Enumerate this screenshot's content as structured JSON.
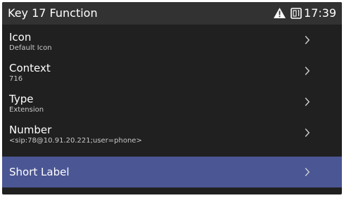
{
  "header": {
    "title": "Key 17 Function",
    "time": "17:39",
    "warning_icon": "warning-icon",
    "line_icon": "line-key-1-icon"
  },
  "menu": {
    "items": [
      {
        "label": "Icon",
        "value": "Default Icon",
        "icon": "chevron-right-icon"
      },
      {
        "label": "Context",
        "value": "716",
        "icon": "chevron-right-icon"
      },
      {
        "label": "Type",
        "value": "Extension",
        "icon": "chevron-right-icon"
      },
      {
        "label": "Number",
        "value": "<sip:78@10.91.20.221;user=phone>",
        "icon": "chevron-right-icon"
      },
      {
        "label": "Short Label",
        "value": "",
        "icon": "chevron-right-icon",
        "selected": true
      }
    ]
  },
  "colors": {
    "screen_background": "#202020",
    "header_background": "#323232",
    "selected_row": "#4b5694",
    "primary_text": "#ffffff",
    "secondary_text": "#c8c8c8"
  }
}
